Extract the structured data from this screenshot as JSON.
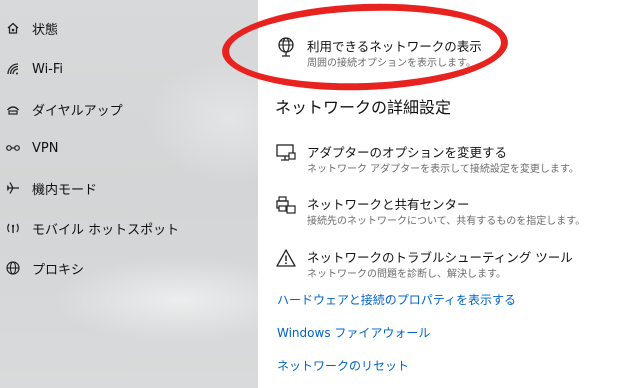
{
  "sidebar": {
    "items": [
      {
        "label": "状態",
        "icon": "home-network-icon"
      },
      {
        "label": "Wi-Fi",
        "icon": "wifi-icon"
      },
      {
        "label": "ダイヤルアップ",
        "icon": "dialup-icon"
      },
      {
        "label": "VPN",
        "icon": "vpn-icon"
      },
      {
        "label": "機内モード",
        "icon": "airplane-icon"
      },
      {
        "label": "モバイル ホットスポット",
        "icon": "hotspot-icon"
      },
      {
        "label": "プロキシ",
        "icon": "globe-icon"
      }
    ]
  },
  "main": {
    "available_networks": {
      "title": "利用できるネットワークの表示",
      "subtitle": "周囲の接続オプションを表示します。",
      "icon": "globe-network-icon",
      "highlight_color": "#e8231f"
    },
    "advanced_heading": "ネットワークの詳細設定",
    "settings": [
      {
        "title": "アダプターのオプションを変更する",
        "subtitle": "ネットワーク アダプターを表示して接続設定を変更します。",
        "icon": "monitor-adapter-icon"
      },
      {
        "title": "ネットワークと共有センター",
        "subtitle": "接続先のネットワークについて、共有するものを指定します。",
        "icon": "printer-share-icon"
      },
      {
        "title": "ネットワークのトラブルシューティング ツール",
        "subtitle": "ネットワークの問題を診断し、解決します。",
        "icon": "warning-icon"
      }
    ],
    "links": [
      {
        "label": "ハードウェアと接続のプロパティを表示する"
      },
      {
        "label": "Windows ファイアウォール"
      },
      {
        "label": "ネットワークのリセット"
      }
    ],
    "link_color": "#0063c7"
  }
}
